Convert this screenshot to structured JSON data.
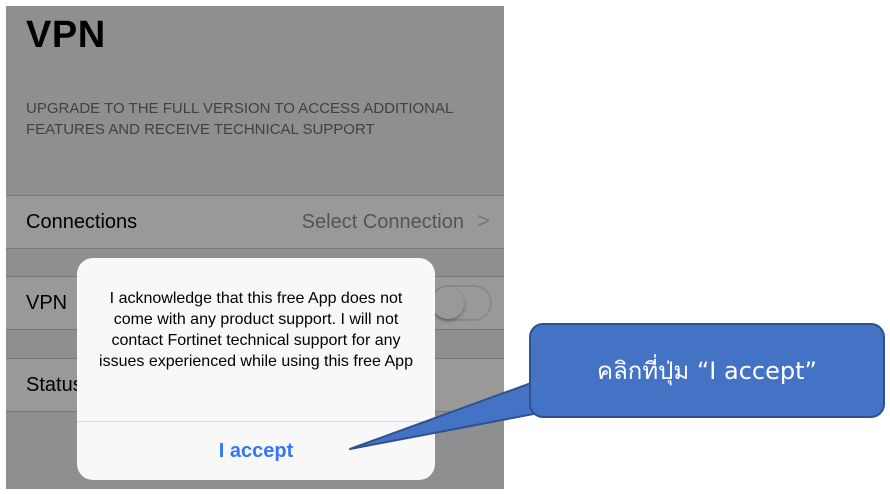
{
  "screen": {
    "title": "VPN",
    "upgrade_text": "UPGRADE TO THE FULL VERSION TO ACCESS ADDITIONAL FEATURES AND RECEIVE TECHNICAL SUPPORT",
    "rows": {
      "connections_label": "Connections",
      "connections_value": "Select Connection",
      "vpn_label": "VPN",
      "status_label": "Status"
    }
  },
  "alert": {
    "message": "I acknowledge that this free App does not come with any product support. I will not contact Fortinet technical support for any issues experienced while using this free App",
    "button_label": "I accept",
    "button_color": "#3377ff"
  },
  "callout": {
    "text": "คลิกที่ปุ่ม “I accept”",
    "color": "#4472c4"
  }
}
